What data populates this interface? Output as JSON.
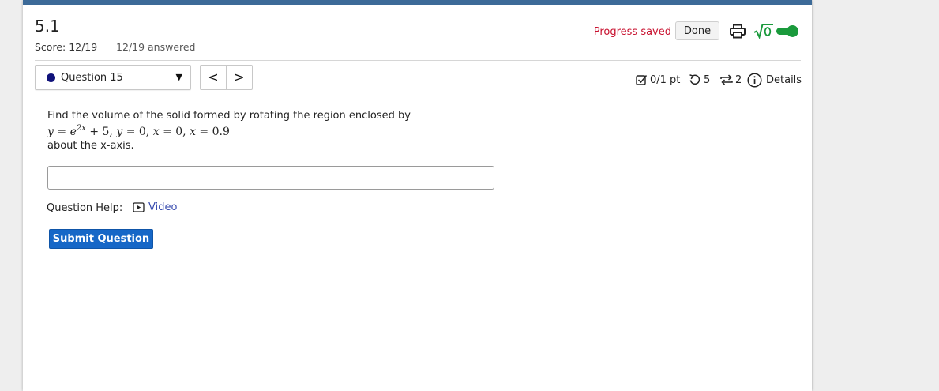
{
  "header": {
    "title": "5.1",
    "score": "Score: 12/19",
    "answered": "12/19 answered",
    "progress_status": "Progress saved",
    "done_label": "Done",
    "math_toggle_on": true
  },
  "question_nav": {
    "selected_label": "Question 15",
    "prev_symbol": "<",
    "next_symbol": ">"
  },
  "meta": {
    "points": "0/1 pt",
    "retries": "5",
    "attempts": "2",
    "details": "Details"
  },
  "question": {
    "prompt": "Find the volume of the solid formed by rotating the region enclosed by",
    "math": {
      "y1": "y",
      "eq": "=",
      "base": "e",
      "exponent": "2x",
      "plus5": "+ 5,",
      "y2": "y",
      "zero1": "0,",
      "x1": "x",
      "zero2": "0,",
      "x2": "x",
      "val": "0.9"
    },
    "suffix": "about the x-axis.",
    "answer_value": ""
  },
  "help": {
    "label": "Question Help:",
    "video_label": "Video"
  },
  "submit_label": "Submit Question",
  "colors": {
    "top_bar": "#3c6a98",
    "saved_text": "#c8102e",
    "submit_bg": "#1667c7",
    "toggle_green": "#1a9a3c",
    "link": "#3a4db0",
    "question_dot": "#10127a"
  }
}
